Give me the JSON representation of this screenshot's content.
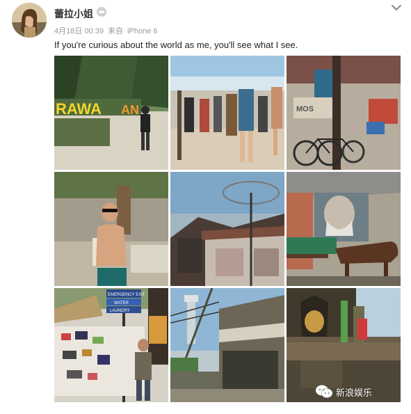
{
  "user": {
    "name": "蕾拉小姐",
    "badge_icon": "vip-crown-icon"
  },
  "meta": {
    "date": "4月18日 00:39",
    "source_prefix": "来自",
    "device": "iPhone 6"
  },
  "content": {
    "text": "If you're curious about the world as me, you'll see what I see."
  },
  "photos": [
    {
      "sign_text": "RAWA",
      "sign_text_2": "AN"
    },
    {},
    {
      "shop_sign": "MOS"
    },
    {},
    {},
    {},
    {
      "sign_1": "EMERGENCY EXIT",
      "sign_2": "WATER",
      "sign_3": "LAUNDRY"
    },
    {},
    {}
  ],
  "watermark": {
    "text": "新浪娱乐",
    "icon": "wechat-icon"
  },
  "colors": {
    "accent": "#ff8200",
    "meta": "#999999",
    "text": "#222222"
  }
}
